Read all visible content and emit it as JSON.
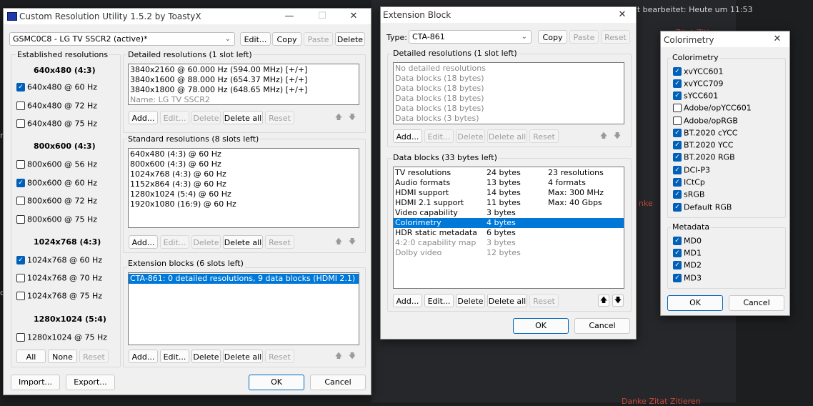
{
  "background": {
    "edited_text": "etzt bearbeitet: Heute um 11:53",
    "link_red_1": "Zitat  Zitieren",
    "link_red_2": "nke",
    "link_red_3": "Danke  Zitat  Zitieren",
    "side_left_1": "n",
    "side_left_2": "d"
  },
  "cru": {
    "title": "Custom Resolution Utility 1.5.2 by ToastyX",
    "monitor_value": "GSMC0C8 - LG TV SSCR2 (active)*",
    "top_buttons": {
      "edit": "Edit...",
      "copy": "Copy",
      "paste": "Paste",
      "delete": "Delete"
    },
    "established": {
      "label": "Established resolutions",
      "groups": [
        {
          "header": "640x480 (4:3)",
          "items": [
            {
              "label": "640x480 @ 60 Hz",
              "checked": true
            },
            {
              "label": "640x480 @ 72 Hz",
              "checked": false
            },
            {
              "label": "640x480 @ 75 Hz",
              "checked": false
            }
          ]
        },
        {
          "header": "800x600 (4:3)",
          "items": [
            {
              "label": "800x600 @ 56 Hz",
              "checked": false
            },
            {
              "label": "800x600 @ 60 Hz",
              "checked": true
            },
            {
              "label": "800x600 @ 72 Hz",
              "checked": false
            },
            {
              "label": "800x600 @ 75 Hz",
              "checked": false
            }
          ]
        },
        {
          "header": "1024x768 (4:3)",
          "items": [
            {
              "label": "1024x768 @ 60 Hz",
              "checked": true
            },
            {
              "label": "1024x768 @ 70 Hz",
              "checked": false
            },
            {
              "label": "1024x768 @ 75 Hz",
              "checked": false
            }
          ]
        },
        {
          "header": "1280x1024 (5:4)",
          "items": [
            {
              "label": "1280x1024 @ 75 Hz",
              "checked": false
            }
          ]
        }
      ],
      "buttons": {
        "all": "All",
        "none": "None",
        "reset": "Reset"
      }
    },
    "detailed": {
      "label": "Detailed resolutions (1 slot left)",
      "items": [
        "3840x2160 @ 60.000 Hz (594.00 MHz) [+/+]",
        "3840x1600 @ 88.000 Hz (654.37 MHz) [+/+]",
        "3840x1800 @ 78.000 Hz (648.65 MHz) [+/+]"
      ],
      "name_item": "Name: LG TV SSCR2"
    },
    "standard": {
      "label": "Standard resolutions (8 slots left)",
      "items": [
        "640x480 (4:3) @ 60 Hz",
        "800x600 (4:3) @ 60 Hz",
        "1024x768 (4:3) @ 60 Hz",
        "1152x864 (4:3) @ 60 Hz",
        "1280x1024 (5:4) @ 60 Hz",
        "1920x1080 (16:9) @ 60 Hz"
      ]
    },
    "extension": {
      "label": "Extension blocks (6 slots left)",
      "items": [
        "CTA-861: 0 detailed resolutions, 9 data blocks (HDMI 2.1)"
      ]
    },
    "row_buttons": {
      "add": "Add...",
      "edit": "Edit...",
      "delete": "Delete",
      "delete_all": "Delete all",
      "reset": "Reset"
    },
    "arrows": {
      "up": "🡅",
      "down": "🡇"
    },
    "bottom": {
      "import": "Import...",
      "export": "Export...",
      "ok": "OK",
      "cancel": "Cancel"
    }
  },
  "ext": {
    "title": "Extension Block",
    "type_label": "Type:",
    "type_value": "CTA-861",
    "top_buttons": {
      "copy": "Copy",
      "paste": "Paste",
      "reset": "Reset"
    },
    "detailed": {
      "label": "Detailed resolutions (1 slot left)",
      "items": [
        "No detailed resolutions",
        "Data blocks (18 bytes)",
        "Data blocks (18 bytes)",
        "Data blocks (18 bytes)",
        "Data blocks (18 bytes)",
        "Data blocks (3 bytes)"
      ]
    },
    "datablocks": {
      "label": "Data blocks (33 bytes left)",
      "rows": [
        {
          "name": "TV resolutions",
          "size": "24 bytes",
          "info": "23 resolutions"
        },
        {
          "name": "Audio formats",
          "size": "13 bytes",
          "info": "4 formats"
        },
        {
          "name": "HDMI support",
          "size": "14 bytes",
          "info": "Max: 300 MHz"
        },
        {
          "name": "HDMI 2.1 support",
          "size": "11 bytes",
          "info": "Max: 40 Gbps"
        },
        {
          "name": "Video capability",
          "size": "3 bytes",
          "info": ""
        },
        {
          "name": "Colorimetry",
          "size": "4 bytes",
          "info": ""
        },
        {
          "name": "HDR static metadata",
          "size": "6 bytes",
          "info": ""
        },
        {
          "name": "4:2:0 capability map",
          "size": "3 bytes",
          "info": ""
        },
        {
          "name": "Dolby video",
          "size": "12 bytes",
          "info": ""
        }
      ]
    },
    "row_buttons": {
      "add": "Add...",
      "edit": "Edit...",
      "delete": "Delete",
      "delete_all": "Delete all",
      "reset": "Reset"
    },
    "bottom": {
      "ok": "OK",
      "cancel": "Cancel"
    }
  },
  "color": {
    "title": "Colorimetry",
    "colorimetry_label": "Colorimetry",
    "colorimetry_items": [
      {
        "label": "xvYCC601",
        "checked": true
      },
      {
        "label": "xvYCC709",
        "checked": true
      },
      {
        "label": "sYCC601",
        "checked": true
      },
      {
        "label": "Adobe/opYCC601",
        "checked": false
      },
      {
        "label": "Adobe/opRGB",
        "checked": false
      },
      {
        "label": "BT.2020 cYCC",
        "checked": true
      },
      {
        "label": "BT.2020 YCC",
        "checked": true
      },
      {
        "label": "BT.2020 RGB",
        "checked": true
      },
      {
        "label": "DCI-P3",
        "checked": true
      },
      {
        "label": "ICtCp",
        "checked": true
      },
      {
        "label": "sRGB",
        "checked": true
      },
      {
        "label": "Default RGB",
        "checked": true
      }
    ],
    "metadata_label": "Metadata",
    "metadata_items": [
      {
        "label": "MD0",
        "checked": true
      },
      {
        "label": "MD1",
        "checked": true
      },
      {
        "label": "MD2",
        "checked": true
      },
      {
        "label": "MD3",
        "checked": true
      }
    ],
    "bottom": {
      "ok": "OK",
      "cancel": "Cancel"
    }
  },
  "icons": {
    "close": "✕",
    "minimize": "—",
    "maximize": "☐",
    "check": "✓",
    "dropdown": "⌄"
  },
  "colors": {
    "selection": "#0078d7",
    "checkbox": "#005fb8",
    "accent_button": "#0067c0"
  }
}
